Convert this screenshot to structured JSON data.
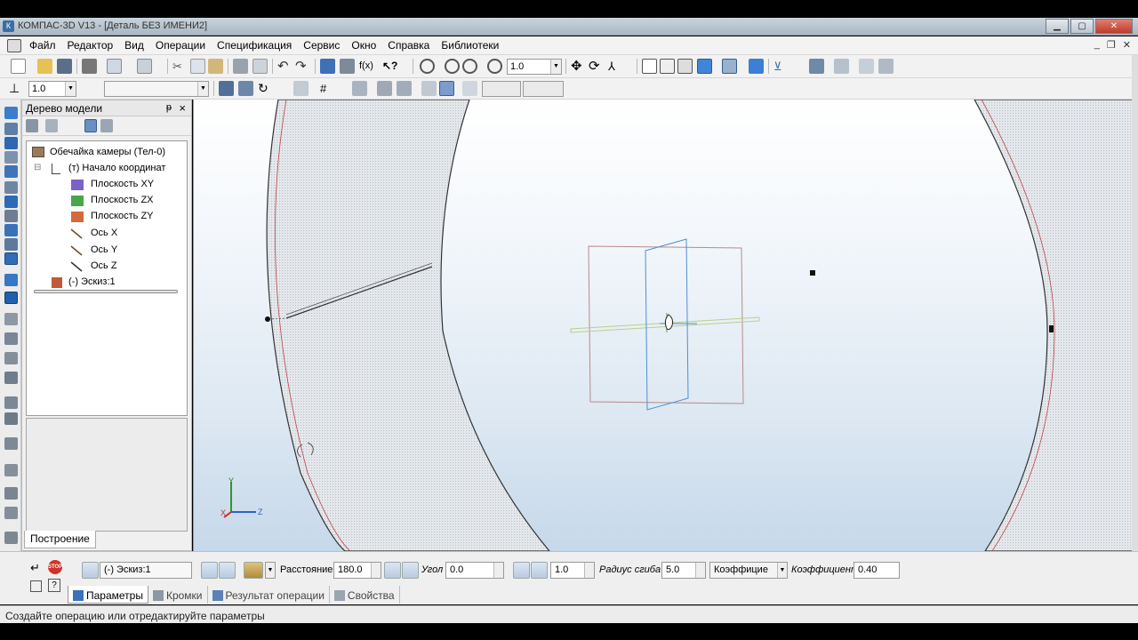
{
  "window": {
    "title": "КОМПАС-3D V13 - [Деталь БЕЗ ИМЕНИ2]",
    "app_icon": "kompas-logo-icon",
    "buttons": [
      "minimize",
      "maximize",
      "close"
    ]
  },
  "menu": {
    "items": [
      "Файл",
      "Редактор",
      "Вид",
      "Операции",
      "Спецификация",
      "Сервис",
      "Окно",
      "Справка",
      "Библиотеки"
    ]
  },
  "toolbar1": {
    "scale_value": "1.0"
  },
  "toolbar2": {
    "step_value": "1.0"
  },
  "tree": {
    "title": "Дерево модели",
    "pin": "ᵽ",
    "close": "×",
    "root": "Обечайка камеры (Тел-0)",
    "origin": "(т) Начало координат",
    "planes": [
      "Плоскость XY",
      "Плоскость ZX",
      "Плоскость ZY"
    ],
    "axes": [
      "Ось X",
      "Ось Y",
      "Ось Z"
    ],
    "sketch": "(-) Эскиз:1",
    "tab_label": "Построение"
  },
  "viewport": {
    "axis_y": "Y",
    "axis_x": "X",
    "axis_z": "Z"
  },
  "properties": {
    "sketch_field": "(-) Эскиз:1",
    "distance_label": "Расстояние",
    "distance_value": "180.0",
    "angle_label": "Угол",
    "angle_value": "0.0",
    "thickness_value": "1.0",
    "bend_radius_label": "Радиус сгиба",
    "bend_radius_value": "5.0",
    "coef_combo": "Коэффицие",
    "coef_label": "Коэффициент",
    "coef_value": "0.40",
    "tabs": [
      "Параметры",
      "Кромки",
      "Результат операции",
      "Свойства"
    ]
  },
  "status": {
    "text": "Создайте операцию или отредактируйте параметры"
  }
}
